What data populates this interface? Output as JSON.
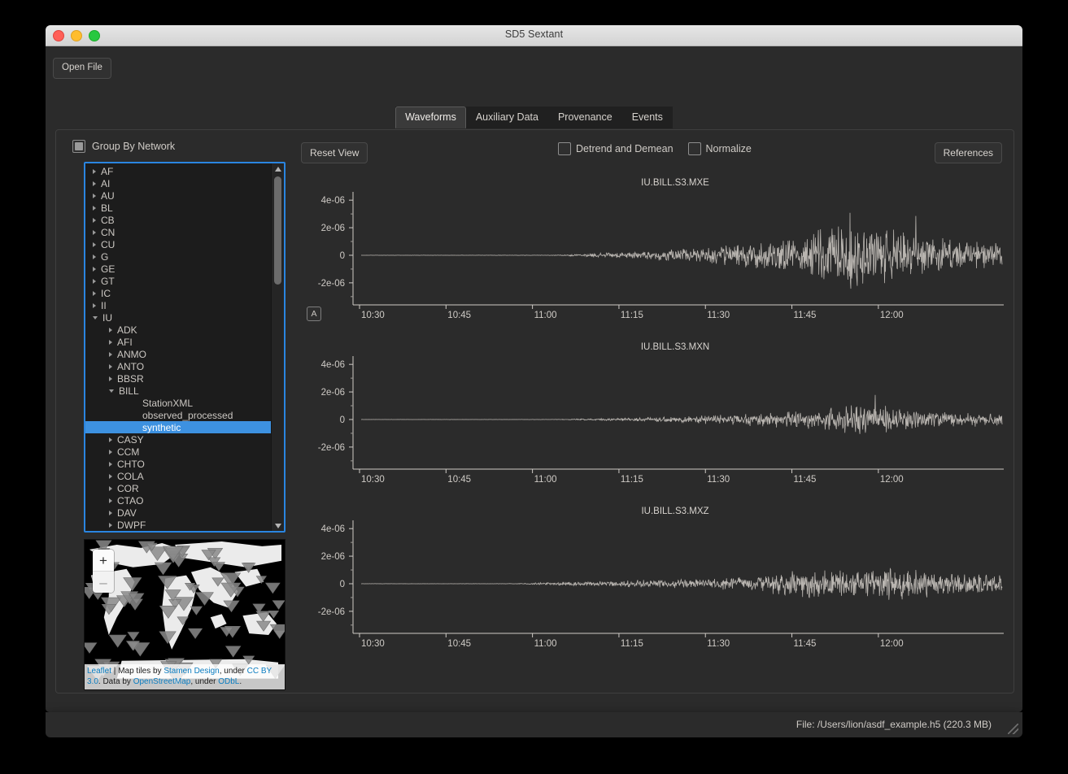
{
  "window": {
    "title": "SD5 Sextant",
    "traffic_lights": [
      "close",
      "minimize",
      "maximize"
    ]
  },
  "toolbar": {
    "open_file_label": "Open File"
  },
  "tabs": [
    {
      "label": "Waveforms",
      "active": true
    },
    {
      "label": "Auxiliary Data",
      "active": false
    },
    {
      "label": "Provenance",
      "active": false
    },
    {
      "label": "Events",
      "active": false
    }
  ],
  "sidebar": {
    "group_by_network_label": "Group By Network",
    "group_by_network_state": "partial",
    "tree": [
      {
        "label": "AF",
        "level": 0,
        "expander": "collapsed",
        "selected": false
      },
      {
        "label": "AI",
        "level": 0,
        "expander": "collapsed",
        "selected": false
      },
      {
        "label": "AU",
        "level": 0,
        "expander": "collapsed",
        "selected": false
      },
      {
        "label": "BL",
        "level": 0,
        "expander": "collapsed",
        "selected": false
      },
      {
        "label": "CB",
        "level": 0,
        "expander": "collapsed",
        "selected": false
      },
      {
        "label": "CN",
        "level": 0,
        "expander": "collapsed",
        "selected": false
      },
      {
        "label": "CU",
        "level": 0,
        "expander": "collapsed",
        "selected": false
      },
      {
        "label": "G",
        "level": 0,
        "expander": "collapsed",
        "selected": false
      },
      {
        "label": "GE",
        "level": 0,
        "expander": "collapsed",
        "selected": false
      },
      {
        "label": "GT",
        "level": 0,
        "expander": "collapsed",
        "selected": false
      },
      {
        "label": "IC",
        "level": 0,
        "expander": "collapsed",
        "selected": false
      },
      {
        "label": "II",
        "level": 0,
        "expander": "collapsed",
        "selected": false
      },
      {
        "label": "IU",
        "level": 0,
        "expander": "expanded",
        "selected": false
      },
      {
        "label": "ADK",
        "level": 1,
        "expander": "collapsed",
        "selected": false
      },
      {
        "label": "AFI",
        "level": 1,
        "expander": "collapsed",
        "selected": false
      },
      {
        "label": "ANMO",
        "level": 1,
        "expander": "collapsed",
        "selected": false
      },
      {
        "label": "ANTO",
        "level": 1,
        "expander": "collapsed",
        "selected": false
      },
      {
        "label": "BBSR",
        "level": 1,
        "expander": "collapsed",
        "selected": false
      },
      {
        "label": "BILL",
        "level": 1,
        "expander": "expanded",
        "selected": false
      },
      {
        "label": "StationXML",
        "level": 2,
        "expander": "none",
        "selected": false
      },
      {
        "label": "observed_processed",
        "level": 2,
        "expander": "none",
        "selected": false
      },
      {
        "label": "synthetic",
        "level": 2,
        "expander": "none",
        "selected": true
      },
      {
        "label": "CASY",
        "level": 1,
        "expander": "collapsed",
        "selected": false
      },
      {
        "label": "CCM",
        "level": 1,
        "expander": "collapsed",
        "selected": false
      },
      {
        "label": "CHTO",
        "level": 1,
        "expander": "collapsed",
        "selected": false
      },
      {
        "label": "COLA",
        "level": 1,
        "expander": "collapsed",
        "selected": false
      },
      {
        "label": "COR",
        "level": 1,
        "expander": "collapsed",
        "selected": false
      },
      {
        "label": "CTAO",
        "level": 1,
        "expander": "collapsed",
        "selected": false
      },
      {
        "label": "DAV",
        "level": 1,
        "expander": "collapsed",
        "selected": false
      },
      {
        "label": "DWPF",
        "level": 1,
        "expander": "collapsed",
        "selected": false
      }
    ]
  },
  "map": {
    "zoom_in_label": "+",
    "zoom_out_label": "–",
    "attribution": {
      "leaflet": "Leaflet",
      "separator": " | ",
      "tiles_prefix": "Map tiles by ",
      "stamen": "Stamen Design",
      "under_1": ", under ",
      "cc_by": "CC BY 3.0",
      "data_prefix": ". Data by ",
      "osm": "OpenStreetMap",
      "under_2": ", under ",
      "odbl": "ODbL",
      "end": "."
    }
  },
  "plot_toolbar": {
    "reset_view_label": "Reset View",
    "references_label": "References",
    "detrend_label": "Detrend and Demean",
    "detrend_checked": false,
    "normalize_label": "Normalize",
    "normalize_checked": false,
    "autoscale_label": "A"
  },
  "statusbar": {
    "file_text": "File: /Users/lion/asdf_example.h5     (220.3 MB)"
  },
  "chart_data": [
    {
      "type": "line",
      "title": "IU.BILL.S3.MXE",
      "xlabel": "",
      "ylabel": "",
      "x_ticks": [
        "10:30",
        "10:45",
        "11:00",
        "11:15",
        "11:30",
        "11:45",
        "12:00"
      ],
      "y_ticks": [
        "4e-06",
        "2e-06",
        "0",
        "-2e-06"
      ],
      "ylim": [
        -3.6e-06,
        4.6e-06
      ],
      "grid": false,
      "legend": "none",
      "trace_color": "#b9b5b0",
      "onset_fraction": 0.33,
      "peak_fraction": 0.77,
      "peak_amplitude": 3.6e-06,
      "envelope": [
        {
          "t": 0.0,
          "a": 0.002
        },
        {
          "t": 0.3,
          "a": 0.004
        },
        {
          "t": 0.36,
          "a": 0.04
        },
        {
          "t": 0.44,
          "a": 0.09
        },
        {
          "t": 0.52,
          "a": 0.16
        },
        {
          "t": 0.58,
          "a": 0.24
        },
        {
          "t": 0.64,
          "a": 0.34
        },
        {
          "t": 0.7,
          "a": 0.45
        },
        {
          "t": 0.76,
          "a": 0.92
        },
        {
          "t": 0.8,
          "a": 0.62
        },
        {
          "t": 0.86,
          "a": 0.55
        },
        {
          "t": 0.92,
          "a": 0.35
        },
        {
          "t": 1.0,
          "a": 0.26
        }
      ]
    },
    {
      "type": "line",
      "title": "IU.BILL.S3.MXN",
      "xlabel": "",
      "ylabel": "",
      "x_ticks": [
        "10:30",
        "10:45",
        "11:00",
        "11:15",
        "11:30",
        "11:45",
        "12:00"
      ],
      "y_ticks": [
        "4e-06",
        "2e-06",
        "0",
        "-2e-06"
      ],
      "ylim": [
        -3.6e-06,
        4.6e-06
      ],
      "grid": false,
      "legend": "none",
      "trace_color": "#b9b5b0",
      "onset_fraction": 0.33,
      "peak_fraction": 0.78,
      "peak_amplitude": 2.2e-06,
      "envelope": [
        {
          "t": 0.0,
          "a": 0.002
        },
        {
          "t": 0.3,
          "a": 0.004
        },
        {
          "t": 0.36,
          "a": 0.03
        },
        {
          "t": 0.44,
          "a": 0.07
        },
        {
          "t": 0.52,
          "a": 0.13
        },
        {
          "t": 0.58,
          "a": 0.2
        },
        {
          "t": 0.64,
          "a": 0.27
        },
        {
          "t": 0.7,
          "a": 0.35
        },
        {
          "t": 0.78,
          "a": 0.58
        },
        {
          "t": 0.84,
          "a": 0.4
        },
        {
          "t": 0.9,
          "a": 0.3
        },
        {
          "t": 1.0,
          "a": 0.22
        }
      ]
    },
    {
      "type": "line",
      "title": "IU.BILL.S3.MXZ",
      "xlabel": "",
      "ylabel": "",
      "x_ticks": [
        "10:30",
        "10:45",
        "11:00",
        "11:15",
        "11:30",
        "11:45",
        "12:00"
      ],
      "y_ticks": [
        "4e-06",
        "2e-06",
        "0",
        "-2e-06"
      ],
      "ylim": [
        -3.6e-06,
        4.6e-06
      ],
      "grid": false,
      "legend": "none",
      "trace_color": "#b9b5b0",
      "onset_fraction": 0.26,
      "peak_fraction": 0.72,
      "peak_amplitude": 2.4e-06,
      "envelope": [
        {
          "t": 0.0,
          "a": 0.002
        },
        {
          "t": 0.24,
          "a": 0.005
        },
        {
          "t": 0.3,
          "a": 0.05
        },
        {
          "t": 0.38,
          "a": 0.09
        },
        {
          "t": 0.46,
          "a": 0.13
        },
        {
          "t": 0.54,
          "a": 0.17
        },
        {
          "t": 0.62,
          "a": 0.26
        },
        {
          "t": 0.7,
          "a": 0.55
        },
        {
          "t": 0.76,
          "a": 0.42
        },
        {
          "t": 0.84,
          "a": 0.6
        },
        {
          "t": 0.9,
          "a": 0.38
        },
        {
          "t": 1.0,
          "a": 0.3
        }
      ]
    }
  ]
}
